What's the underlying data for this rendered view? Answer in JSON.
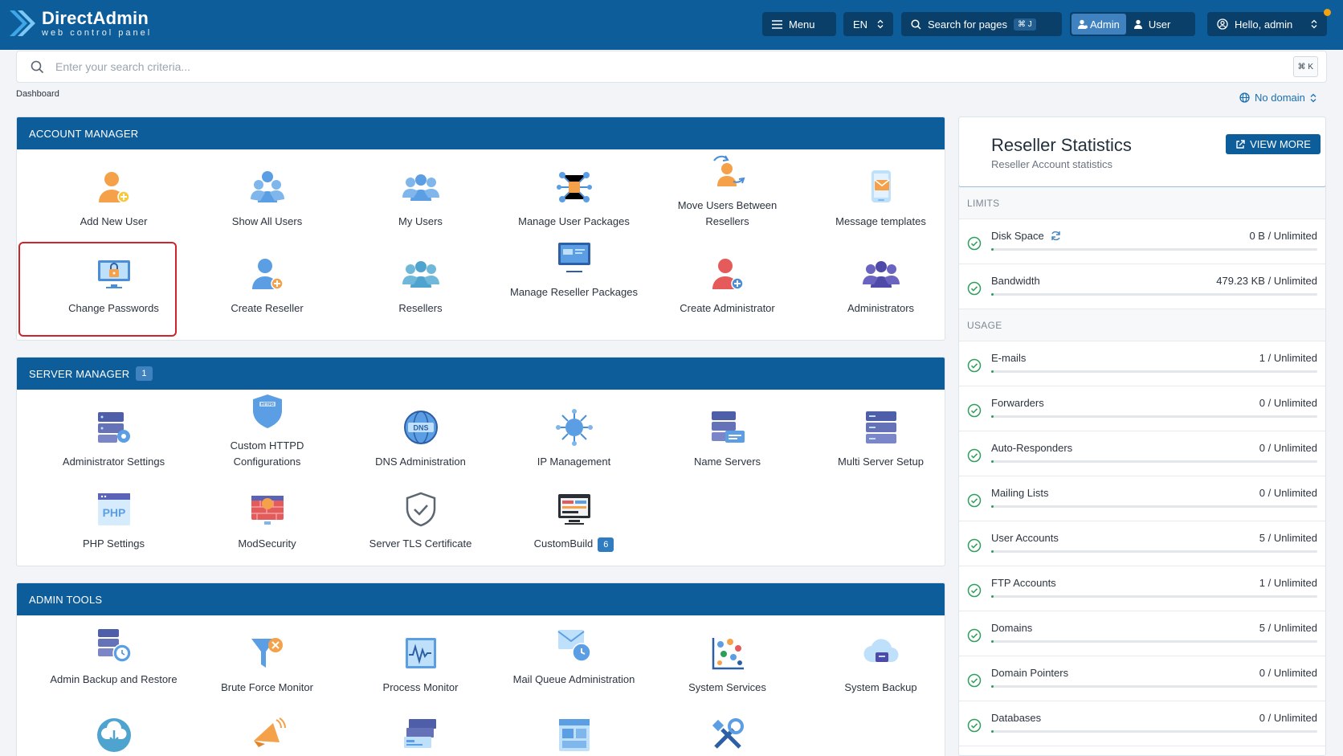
{
  "brand": {
    "title": "DirectAdmin",
    "subtitle": "web control panel"
  },
  "topbar": {
    "menu_label": "Menu",
    "lang_label": "EN",
    "search_pages_label": "Search for pages",
    "search_pages_kbd": "⌘ J",
    "admin_label": "Admin",
    "user_label": "User",
    "hello_label": "Hello, admin"
  },
  "search": {
    "placeholder": "Enter your search criteria...",
    "kbd": "⌘ K"
  },
  "breadcrumb": "Dashboard",
  "domain_selector": "No domain",
  "account_manager": {
    "title": "ACCOUNT MANAGER",
    "items": [
      {
        "label": "Add New User",
        "icon": "add-user-icon"
      },
      {
        "label": "Show All Users",
        "icon": "users-group-icon"
      },
      {
        "label": "My Users",
        "icon": "my-users-icon"
      },
      {
        "label": "Manage User Packages",
        "icon": "packages-network-icon"
      },
      {
        "label": "Move Users Between Resellers",
        "icon": "move-users-icon"
      },
      {
        "label": "Message templates",
        "icon": "message-template-icon"
      },
      {
        "label": "Change Passwords",
        "icon": "password-lock-icon"
      },
      {
        "label": "Create Reseller",
        "icon": "create-reseller-icon"
      },
      {
        "label": "Resellers",
        "icon": "resellers-icon"
      },
      {
        "label": "Manage Reseller Packages",
        "icon": "reseller-packages-icon"
      },
      {
        "label": "Create Administrator",
        "icon": "create-admin-icon"
      },
      {
        "label": "Administrators",
        "icon": "administrators-icon"
      }
    ]
  },
  "server_manager": {
    "title": "SERVER MANAGER",
    "badge": "1",
    "items": [
      {
        "label": "Administrator Settings",
        "icon": "admin-settings-icon"
      },
      {
        "label": "Custom HTTPD Configurations",
        "icon": "httpd-shield-icon"
      },
      {
        "label": "DNS Administration",
        "icon": "dns-globe-icon"
      },
      {
        "label": "IP Management",
        "icon": "ip-network-icon"
      },
      {
        "label": "Name Servers",
        "icon": "name-servers-icon"
      },
      {
        "label": "Multi Server Setup",
        "icon": "multi-server-icon"
      },
      {
        "label": "PHP Settings",
        "icon": "php-icon"
      },
      {
        "label": "ModSecurity",
        "icon": "modsecurity-icon"
      },
      {
        "label": "Server TLS Certificate",
        "icon": "tls-shield-icon"
      },
      {
        "label": "CustomBuild",
        "icon": "custombuild-icon",
        "badge": "6"
      }
    ]
  },
  "admin_tools": {
    "title": "ADMIN TOOLS",
    "items": [
      {
        "label": "Admin Backup and Restore",
        "icon": "backup-restore-icon"
      },
      {
        "label": "Brute Force Monitor",
        "icon": "brute-force-icon"
      },
      {
        "label": "Process Monitor",
        "icon": "process-monitor-icon"
      },
      {
        "label": "Mail Queue Administration",
        "icon": "mail-queue-icon"
      },
      {
        "label": "System Services",
        "icon": "system-services-icon"
      },
      {
        "label": "System Backup",
        "icon": "system-backup-icon"
      },
      {
        "label": "",
        "icon": "cloud-download-icon"
      },
      {
        "label": "",
        "icon": "megaphone-icon"
      },
      {
        "label": "",
        "icon": "stacked-windows-icon"
      },
      {
        "label": "",
        "icon": "layout-icon"
      },
      {
        "label": "",
        "icon": "tools-icon"
      }
    ]
  },
  "reseller_stats": {
    "title": "Reseller Statistics",
    "subtitle": "Reseller Account statistics",
    "view_more": "VIEW MORE",
    "limits_title": "LIMITS",
    "usage_title": "USAGE",
    "limits": [
      {
        "label": "Disk Space",
        "value": "0 B / Unlimited",
        "refresh": true
      },
      {
        "label": "Bandwidth",
        "value": "479.23 KB / Unlimited"
      }
    ],
    "usage": [
      {
        "label": "E-mails",
        "value": "1 / Unlimited"
      },
      {
        "label": "Forwarders",
        "value": "0 / Unlimited"
      },
      {
        "label": "Auto-Responders",
        "value": "0 / Unlimited"
      },
      {
        "label": "Mailing Lists",
        "value": "0 / Unlimited"
      },
      {
        "label": "User Accounts",
        "value": "5 / Unlimited"
      },
      {
        "label": "FTP Accounts",
        "value": "1 / Unlimited"
      },
      {
        "label": "Domains",
        "value": "5 / Unlimited"
      },
      {
        "label": "Domain Pointers",
        "value": "0 / Unlimited"
      },
      {
        "label": "Databases",
        "value": "0 / Unlimited"
      }
    ]
  },
  "colors": {
    "header": "#0d5d9a",
    "accent": "#3f82bf",
    "highlight": "#d0232b",
    "ok": "#2e9e5b"
  }
}
